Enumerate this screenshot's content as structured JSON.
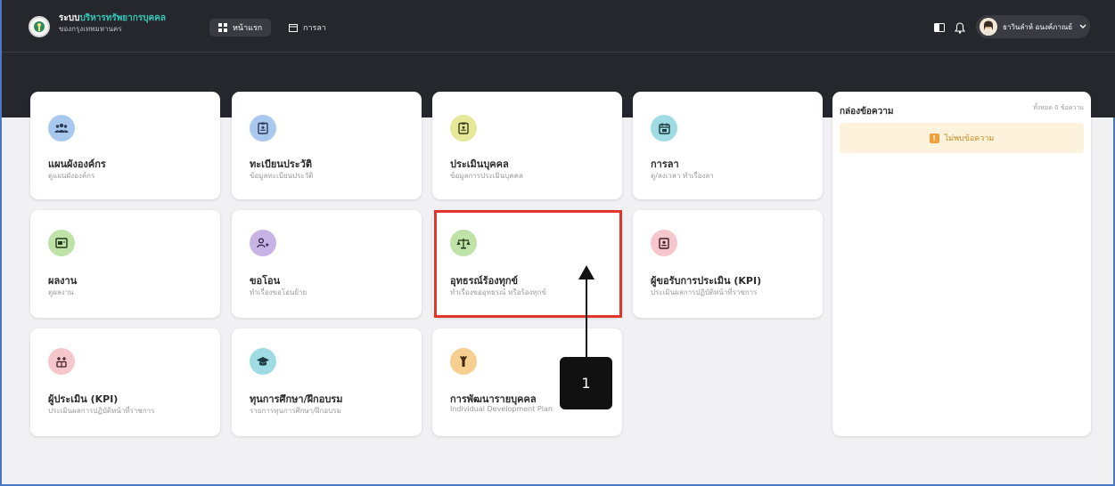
{
  "header": {
    "brand_prefix": "ระบบ",
    "brand_highlight": "บริหารทรัพยากรบุคคล",
    "brand_sub": "ของกรุงเทพมหานคร",
    "nav_home": "หน้าแรก",
    "nav_leave": "การลา",
    "user_name": "ธาวินลำห์ อนงค์ภาณย์"
  },
  "cards": [
    {
      "title": "แผนผังองค์กร",
      "sub": "ดูแผนผังองค์กร",
      "icon": "people-icon",
      "color": "#a9c8ee"
    },
    {
      "title": "ทะเบียนประวัติ",
      "sub": "ข้อมูลทะเบียนประวัติ",
      "icon": "id-card-icon",
      "color": "#a9c8ee"
    },
    {
      "title": "ประเมินบุคคล",
      "sub": "ข้อมูลการประเมินบุคคล",
      "icon": "clipboard-icon",
      "color": "#e5e99a"
    },
    {
      "title": "การลา",
      "sub": "ดู/ลงเวลา ทำเรื่องลา",
      "icon": "calendar-icon",
      "color": "#9fdbe3"
    },
    {
      "title": "ผลงาน",
      "sub": "ดูผลงาน",
      "icon": "folder-icon",
      "color": "#bfe2a8"
    },
    {
      "title": "ขอโอน",
      "sub": "ทำเรื่องขอโอนย้าย",
      "icon": "user-transfer-icon",
      "color": "#c7b3e6"
    },
    {
      "title": "อุทธรณ์ร้องทุกข์",
      "sub": "ทำเรื่องขออุทธรณ์ หรือร้องทุกข์",
      "icon": "scales-icon",
      "color": "#bfe2a8"
    },
    {
      "title": "ผู้ขอรับการประเมิน (KPI)",
      "sub": "ประเมินผลการปฏิบัติหน้าที่ราชการ",
      "icon": "badge-icon",
      "color": "#f5c6cc"
    },
    {
      "title": "ผู้ประเมิน (KPI)",
      "sub": "ประเมินผลการปฏิบัติหน้าที่ราชการ",
      "icon": "people-plus-icon",
      "color": "#f5c6cc"
    },
    {
      "title": "ทุนการศึกษา/ฝึกอบรม",
      "sub": "รายการทุนการศึกษา/ฝึกอบรม",
      "icon": "graduation-cap-icon",
      "color": "#9fdbe3"
    },
    {
      "title": "การพัฒนารายบุคคล",
      "sub": "Individual Development Plan",
      "icon": "person-up-icon",
      "color": "#f6cf91"
    }
  ],
  "messages": {
    "title": "กล่องข้อความ",
    "count": "ทั้งหมด 0 ข้อความ",
    "empty": "ไม่พบข้อความ"
  },
  "annotation": {
    "number": "1"
  }
}
